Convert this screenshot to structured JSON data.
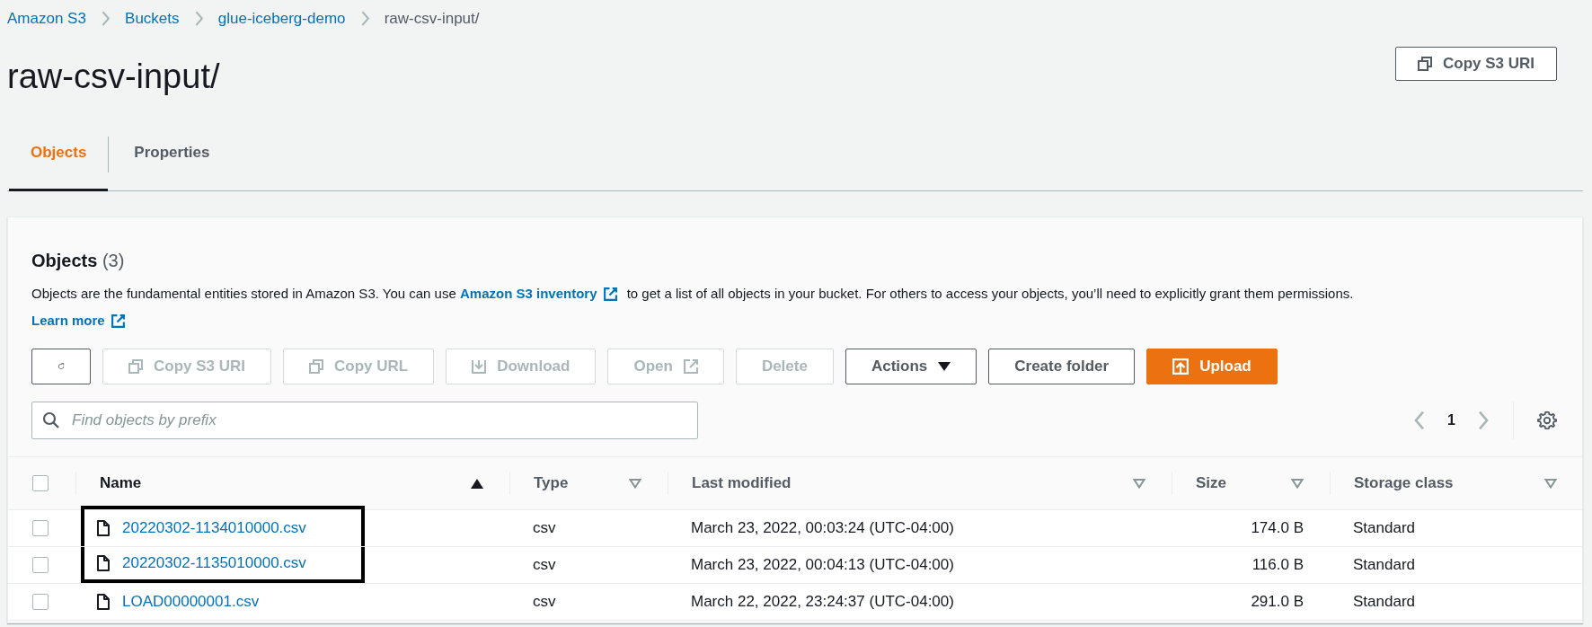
{
  "breadcrumb": [
    {
      "label": "Amazon S3",
      "link": true
    },
    {
      "label": "Buckets",
      "link": true
    },
    {
      "label": "glue-iceberg-demo",
      "link": true
    },
    {
      "label": "raw-csv-input/",
      "link": false
    }
  ],
  "title": "raw-csv-input/",
  "header_button": {
    "label": "Copy S3 URI",
    "kind": "copy",
    "disabled": false
  },
  "tabs": [
    {
      "label": "Objects",
      "selected": true
    },
    {
      "label": "Properties",
      "selected": false
    }
  ],
  "panel": {
    "heading": "Objects",
    "count": "(3)",
    "description": [
      {
        "kind": "text",
        "text": "Objects are the fundamental entities stored in Amazon S3. You can use "
      },
      {
        "kind": "link",
        "text": "Amazon S3 inventory",
        "external": true
      },
      {
        "kind": "text",
        "text": " to get a list of all objects in your bucket. For others to access your objects, you’ll need to explicitly grant them permissions. "
      },
      {
        "kind": "link",
        "text": "Learn more",
        "external": true
      }
    ],
    "toolbar": [
      {
        "kind": "refresh",
        "disabled": false
      },
      {
        "kind": "copy",
        "label": "Copy S3 URI",
        "disabled": true
      },
      {
        "kind": "copy",
        "label": "Copy URL",
        "disabled": true
      },
      {
        "kind": "download",
        "label": "Download",
        "disabled": true
      },
      {
        "kind": "open",
        "label": "Open",
        "disabled": true
      },
      {
        "kind": "plain",
        "label": "Delete",
        "disabled": true
      },
      {
        "kind": "dropdown",
        "label": "Actions",
        "disabled": false
      },
      {
        "kind": "plain",
        "label": "Create folder",
        "disabled": false
      },
      {
        "kind": "upload",
        "label": "Upload",
        "disabled": false
      }
    ],
    "search": {
      "placeholder": "Find objects by prefix"
    },
    "pagination": {
      "page": "1",
      "prev_disabled": true,
      "next_disabled": true
    },
    "table": {
      "select_all": {
        "checked": false
      },
      "columns": [
        {
          "label": "Name",
          "sorted": true
        },
        {
          "label": "Type",
          "sorted": false
        },
        {
          "label": "Last modified",
          "sorted": false
        },
        {
          "label": "Size",
          "sorted": false
        },
        {
          "label": "Storage class",
          "sorted": false
        }
      ],
      "rows": [
        {
          "checked": false,
          "highlighted": true,
          "name": "20220302-1134010000.csv",
          "type": "csv",
          "last_modified": "March 23, 2022, 00:03:24 (UTC-04:00)",
          "size": "174.0 B",
          "storage_class": "Standard"
        },
        {
          "checked": false,
          "highlighted": true,
          "name": "20220302-1135010000.csv",
          "type": "csv",
          "last_modified": "March 23, 2022, 00:04:13 (UTC-04:00)",
          "size": "116.0 B",
          "storage_class": "Standard"
        },
        {
          "checked": false,
          "highlighted": false,
          "name": "LOAD00000001.csv",
          "type": "csv",
          "last_modified": "March 22, 2022, 23:24:37 (UTC-04:00)",
          "size": "291.0 B",
          "storage_class": "Standard"
        }
      ]
    }
  }
}
